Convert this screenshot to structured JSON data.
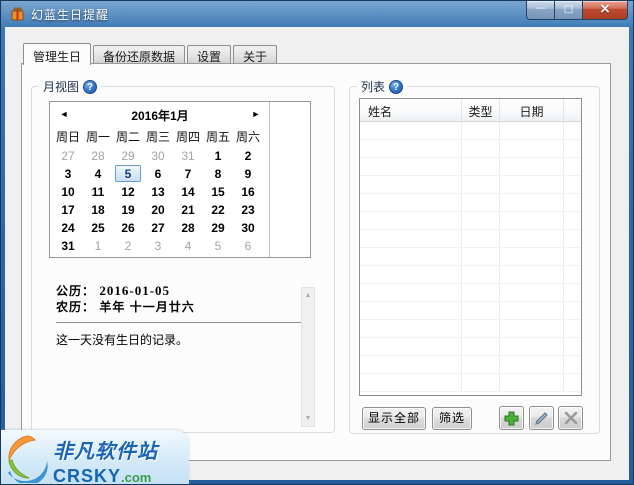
{
  "window": {
    "title": "幻蓝生日提醒",
    "buttons": {
      "minimize": "—",
      "maximize": "□",
      "close": "×"
    }
  },
  "tabs": [
    {
      "label": "管理生日",
      "active": true
    },
    {
      "label": "备份还原数据",
      "active": false
    },
    {
      "label": "设置",
      "active": false
    },
    {
      "label": "关于",
      "active": false
    }
  ],
  "month_view": {
    "label": "月视图",
    "calendar": {
      "title": "2016年1月",
      "prev_glyph": "◄",
      "next_glyph": "►",
      "weekdays": [
        "周日",
        "周一",
        "周二",
        "周三",
        "周四",
        "周五",
        "周六"
      ],
      "days": [
        {
          "d": "27",
          "s": "muted"
        },
        {
          "d": "28",
          "s": "muted"
        },
        {
          "d": "29",
          "s": "muted"
        },
        {
          "d": "30",
          "s": "muted"
        },
        {
          "d": "31",
          "s": "muted"
        },
        {
          "d": "1",
          "s": "normal"
        },
        {
          "d": "2",
          "s": "normal"
        },
        {
          "d": "3",
          "s": "normal"
        },
        {
          "d": "4",
          "s": "normal"
        },
        {
          "d": "5",
          "s": "selected"
        },
        {
          "d": "6",
          "s": "normal"
        },
        {
          "d": "7",
          "s": "normal"
        },
        {
          "d": "8",
          "s": "normal"
        },
        {
          "d": "9",
          "s": "normal"
        },
        {
          "d": "10",
          "s": "normal"
        },
        {
          "d": "11",
          "s": "normal"
        },
        {
          "d": "12",
          "s": "normal"
        },
        {
          "d": "13",
          "s": "normal"
        },
        {
          "d": "14",
          "s": "normal"
        },
        {
          "d": "15",
          "s": "normal"
        },
        {
          "d": "16",
          "s": "normal"
        },
        {
          "d": "17",
          "s": "normal"
        },
        {
          "d": "18",
          "s": "normal"
        },
        {
          "d": "19",
          "s": "normal"
        },
        {
          "d": "20",
          "s": "normal"
        },
        {
          "d": "21",
          "s": "normal"
        },
        {
          "d": "22",
          "s": "normal"
        },
        {
          "d": "23",
          "s": "normal"
        },
        {
          "d": "24",
          "s": "normal"
        },
        {
          "d": "25",
          "s": "normal"
        },
        {
          "d": "26",
          "s": "normal"
        },
        {
          "d": "27",
          "s": "normal"
        },
        {
          "d": "28",
          "s": "normal"
        },
        {
          "d": "29",
          "s": "normal"
        },
        {
          "d": "30",
          "s": "normal"
        },
        {
          "d": "31",
          "s": "normal"
        },
        {
          "d": "1",
          "s": "muted"
        },
        {
          "d": "2",
          "s": "muted"
        },
        {
          "d": "3",
          "s": "muted"
        },
        {
          "d": "4",
          "s": "muted"
        },
        {
          "d": "5",
          "s": "muted"
        },
        {
          "d": "6",
          "s": "muted"
        }
      ]
    },
    "info": {
      "solar_label": "公历：",
      "solar_value": "2016-01-05",
      "lunar_label": "农历：",
      "lunar_value": "羊年 十一月廿六",
      "message": "这一天没有生日的记录。"
    },
    "scrollbar": {
      "up_glyph": "▲",
      "down_glyph": "▼"
    }
  },
  "list": {
    "label": "列表",
    "columns": [
      "姓名",
      "类型",
      "日期"
    ],
    "rows": [],
    "show_all_label": "显示全部",
    "filter_label": "筛选"
  },
  "icons": {
    "help": "blue-question-mark",
    "add": "green-plus",
    "edit": "pencil",
    "delete": "gray-x",
    "app": "orange-gift"
  },
  "watermark": {
    "line1": "非凡软件站",
    "brand": "CRSKY",
    "tld": ".com"
  },
  "colors": {
    "titlebar_blue": "#2c68a8",
    "close_red": "#c04a30",
    "selection_border": "#689ad3",
    "add_green": "#4fae3a",
    "watermark_blue": "#1b64b4",
    "watermark_green": "#3c9e4d"
  }
}
